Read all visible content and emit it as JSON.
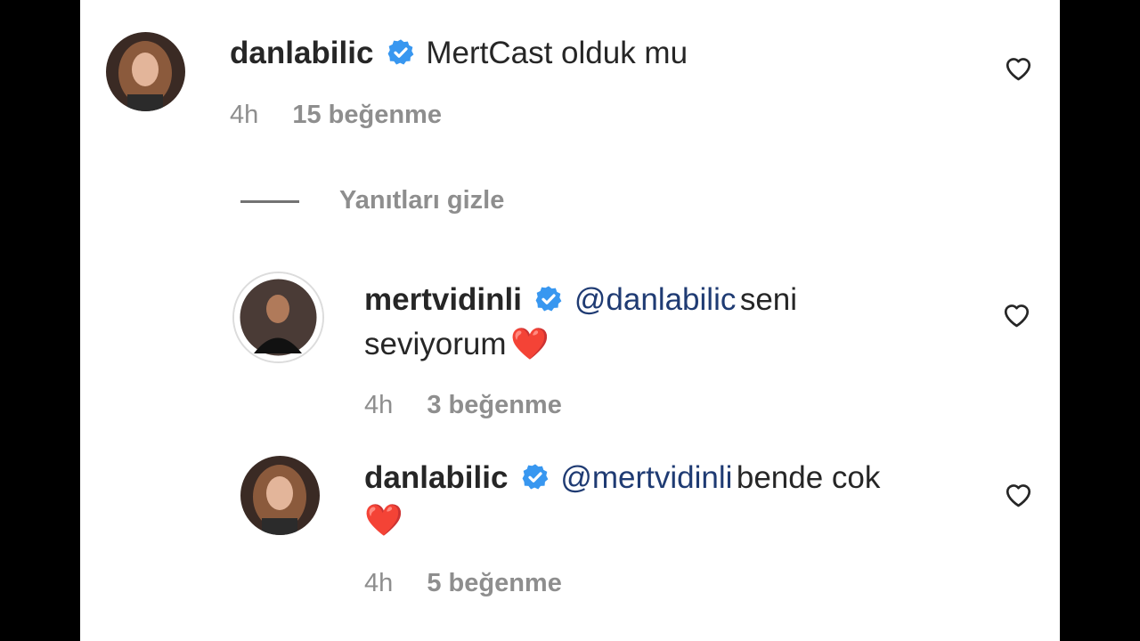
{
  "comments": [
    {
      "username": "danlabilic",
      "text": "MertCast olduk mu",
      "time": "4h",
      "likes": "15 beğenme"
    }
  ],
  "hide_replies_label": "Yanıtları gizle",
  "replies": [
    {
      "username": "mertvidinli",
      "mention": "@danlabilic",
      "text_line1": "seni",
      "text_line2": "seviyorum",
      "emoji": "❤️",
      "time": "4h",
      "likes": "3 beğenme"
    },
    {
      "username": "danlabilic",
      "mention": "@mertvidinli",
      "text_line1": "bende cok",
      "emoji": "❤️",
      "time": "4h",
      "likes": "5 beğenme"
    }
  ],
  "colors": {
    "text": "#262626",
    "meta": "#8e8e8e",
    "mention": "#1f3b73",
    "verified": "#3897f0"
  },
  "icons": [
    "verified-badge-icon",
    "heart-outline-icon"
  ]
}
